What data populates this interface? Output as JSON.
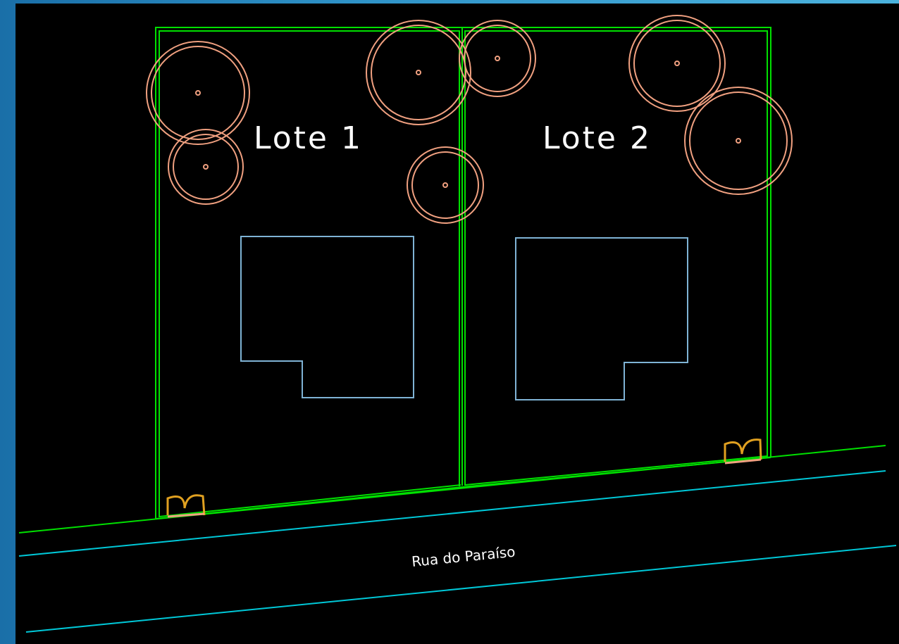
{
  "drawing": {
    "lots": [
      {
        "label": "Lote 1"
      },
      {
        "label": "Lote 2"
      }
    ],
    "street": {
      "name": "Rua do Paraíso"
    }
  },
  "colors": {
    "background": "#000000",
    "lot_boundary": "#00e000",
    "tree": "#f0a080",
    "house": "#7fb3d5",
    "street_edge": "#00c8d8",
    "gate": "#e0a020",
    "frame": "#2a8fc4"
  },
  "icons": {
    "tree": "tree-canopy-icon",
    "gate": "entrance-gate-icon"
  }
}
